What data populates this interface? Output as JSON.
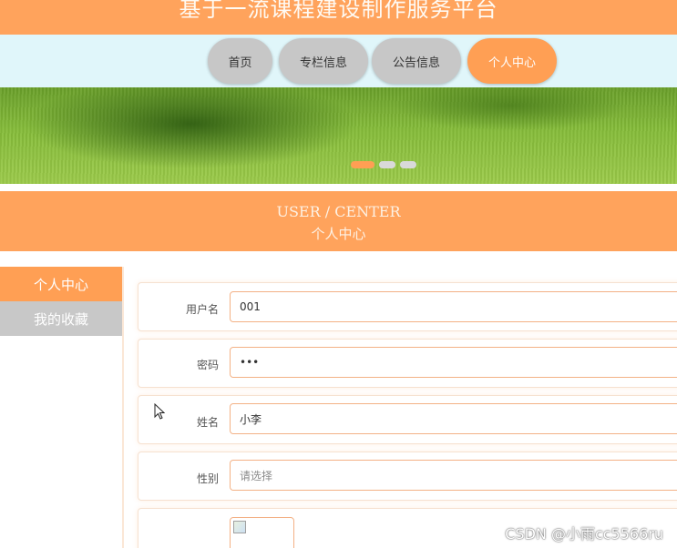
{
  "site": {
    "title": "基于一流课程建设制作服务平台"
  },
  "nav": {
    "items": [
      {
        "label": "首页"
      },
      {
        "label": "专栏信息"
      },
      {
        "label": "公告信息"
      },
      {
        "label": "个人中心"
      }
    ],
    "active_index": 3
  },
  "banner": {
    "slide_count": 3,
    "active_slide": 1
  },
  "section": {
    "title_en": "USER / CENTER",
    "title_cn": "个人中心"
  },
  "sidebar": {
    "items": [
      {
        "label": "个人中心"
      },
      {
        "label": "我的收藏"
      }
    ],
    "active_index": 0
  },
  "form": {
    "username": {
      "label": "用户名",
      "value": "001"
    },
    "password": {
      "label": "密码",
      "value": "•••"
    },
    "name": {
      "label": "姓名",
      "value": "小李"
    },
    "gender": {
      "label": "性别",
      "placeholder": "请选择"
    }
  },
  "watermark": "CSDN @小雨cc5566ru",
  "colors": {
    "accent": "#ffa35c",
    "nav_bg": "#e0f6fa",
    "inactive": "#c7c7c7"
  }
}
